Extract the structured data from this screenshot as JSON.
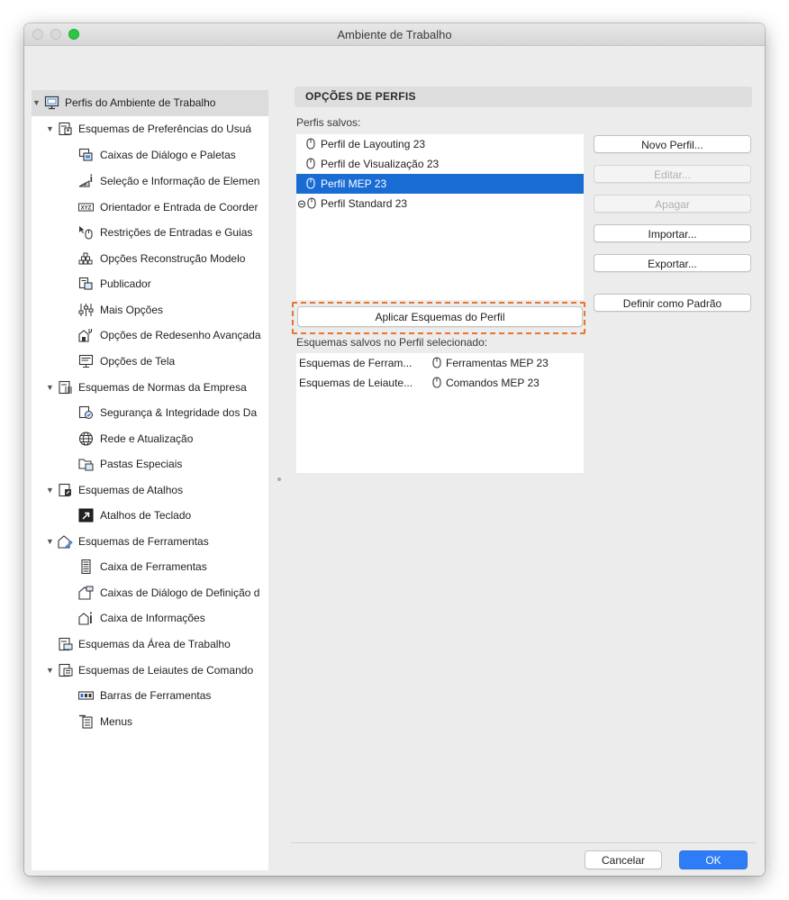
{
  "window": {
    "title": "Ambiente de Trabalho"
  },
  "tree": {
    "items": [
      {
        "label": "Perfis do Ambiente de Trabalho",
        "icon": "profile-monitor-icon"
      },
      {
        "label": "Esquemas de Preferências do Usuá",
        "icon": "user-prefs-icon"
      },
      {
        "label": "Caixas de Diálogo e Paletas",
        "icon": "dialog-palette-icon"
      },
      {
        "label": "Seleção e Informação de Elemen",
        "icon": "selection-info-icon"
      },
      {
        "label": "Orientador e Entrada de Coorder",
        "icon": "xyz-icon"
      },
      {
        "label": "Restrições de Entradas e Guias",
        "icon": "cursor-mouse-icon"
      },
      {
        "label": "Opções Reconstrução Modelo",
        "icon": "rebuild-model-icon"
      },
      {
        "label": "Publicador",
        "icon": "publisher-icon"
      },
      {
        "label": "Mais Opções",
        "icon": "sliders-icon"
      },
      {
        "label": "Opções de Redesenho Avançada",
        "icon": "redraw-icon"
      },
      {
        "label": "Opções de Tela",
        "icon": "screen-icon"
      },
      {
        "label": "Esquemas de Normas da Empresa",
        "icon": "company-standards-icon"
      },
      {
        "label": "Segurança & Integridade dos Da",
        "icon": "data-safety-icon"
      },
      {
        "label": "Rede e Atualização",
        "icon": "globe-icon"
      },
      {
        "label": "Pastas Especiais",
        "icon": "folder-icon"
      },
      {
        "label": "Esquemas de Atalhos",
        "icon": "shortcuts-icon"
      },
      {
        "label": "Atalhos de Teclado",
        "icon": "keyboard-shortcut-icon"
      },
      {
        "label": "Esquemas de Ferramentas",
        "icon": "tools-icon"
      },
      {
        "label": "Caixa de Ferramentas",
        "icon": "toolbox-icon"
      },
      {
        "label": "Caixas de Diálogo de Definição d",
        "icon": "tool-settings-icon"
      },
      {
        "label": "Caixa de Informações",
        "icon": "info-box-icon"
      },
      {
        "label": "Esquemas da Área de Trabalho",
        "icon": "work-area-icon"
      },
      {
        "label": "Esquemas de Leiautes de Comando",
        "icon": "command-layout-icon"
      },
      {
        "label": "Barras de Ferramentas",
        "icon": "toolbar-icon"
      },
      {
        "label": "Menus",
        "icon": "menus-icon"
      }
    ]
  },
  "main": {
    "section_title": "OPÇÕES DE PERFIS",
    "profiles_label": "Perfis salvos:",
    "profiles": [
      {
        "label": "Perfil de Layouting 23",
        "icon": "mouse-icon"
      },
      {
        "label": "Perfil de Visualização 23",
        "icon": "mouse-icon"
      },
      {
        "label": "Perfil MEP 23",
        "icon": "mouse-icon",
        "selected": true
      },
      {
        "label": "Perfil Standard 23",
        "icon": "lock-mouse-icon"
      }
    ],
    "apply_button": "Aplicar Esquemas do Perfil",
    "schemes_label": "Esquemas salvos no Perfil selecionado:",
    "schemes": [
      {
        "type": "Esquemas de Ferram...",
        "value": "Ferramentas MEP 23"
      },
      {
        "type": "Esquemas de Leiaute...",
        "value": "Comandos MEP 23"
      }
    ]
  },
  "buttons": {
    "new": "Novo Perfil...",
    "edit": "Editar...",
    "delete": "Apagar",
    "import": "Importar...",
    "export": "Exportar...",
    "default": "Definir como Padrão",
    "cancel": "Cancelar",
    "ok": "OK"
  },
  "colors": {
    "selection": "#1a6cd5",
    "highlight_border": "#e8752c",
    "ok_button": "#2f7df6"
  }
}
